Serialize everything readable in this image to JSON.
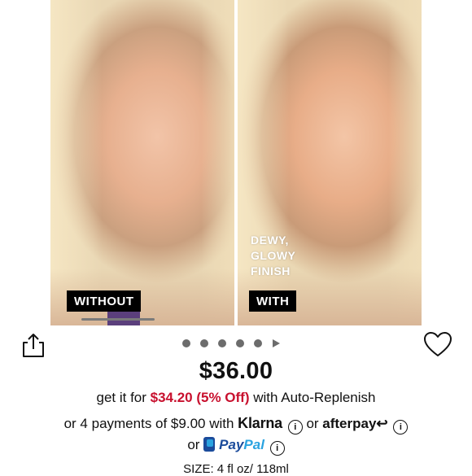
{
  "hero": {
    "without_label": "WITHOUT",
    "with_label": "WITH",
    "finish_text": "DEWY,\nGLOWY\nFINISH"
  },
  "carousel": {
    "dot_count": 5
  },
  "icons": {
    "share": "share-icon",
    "wishlist": "heart-icon",
    "play": "play-icon",
    "info": "info-icon",
    "paypal": "paypal-logo"
  },
  "product": {
    "price": "$36.00",
    "replenish_prefix": "get it for ",
    "replenish_price": "$34.20 (5% Off)",
    "replenish_suffix": " with Auto-Replenish",
    "payments_prefix": "or 4 payments of $9.00 with ",
    "klarna": "Klarna",
    "or": " or ",
    "afterpay": "afterpay",
    "afterpay_symbol": "↩",
    "paypal_or": "or ",
    "paypal_pay": "Pay",
    "paypal_pal": "Pal",
    "size": "SIZE: 4 fl oz/ 118ml"
  },
  "colors": {
    "sale": "#c8102e",
    "paypal_dark": "#1b4b9b",
    "paypal_light": "#2aa3e0"
  }
}
